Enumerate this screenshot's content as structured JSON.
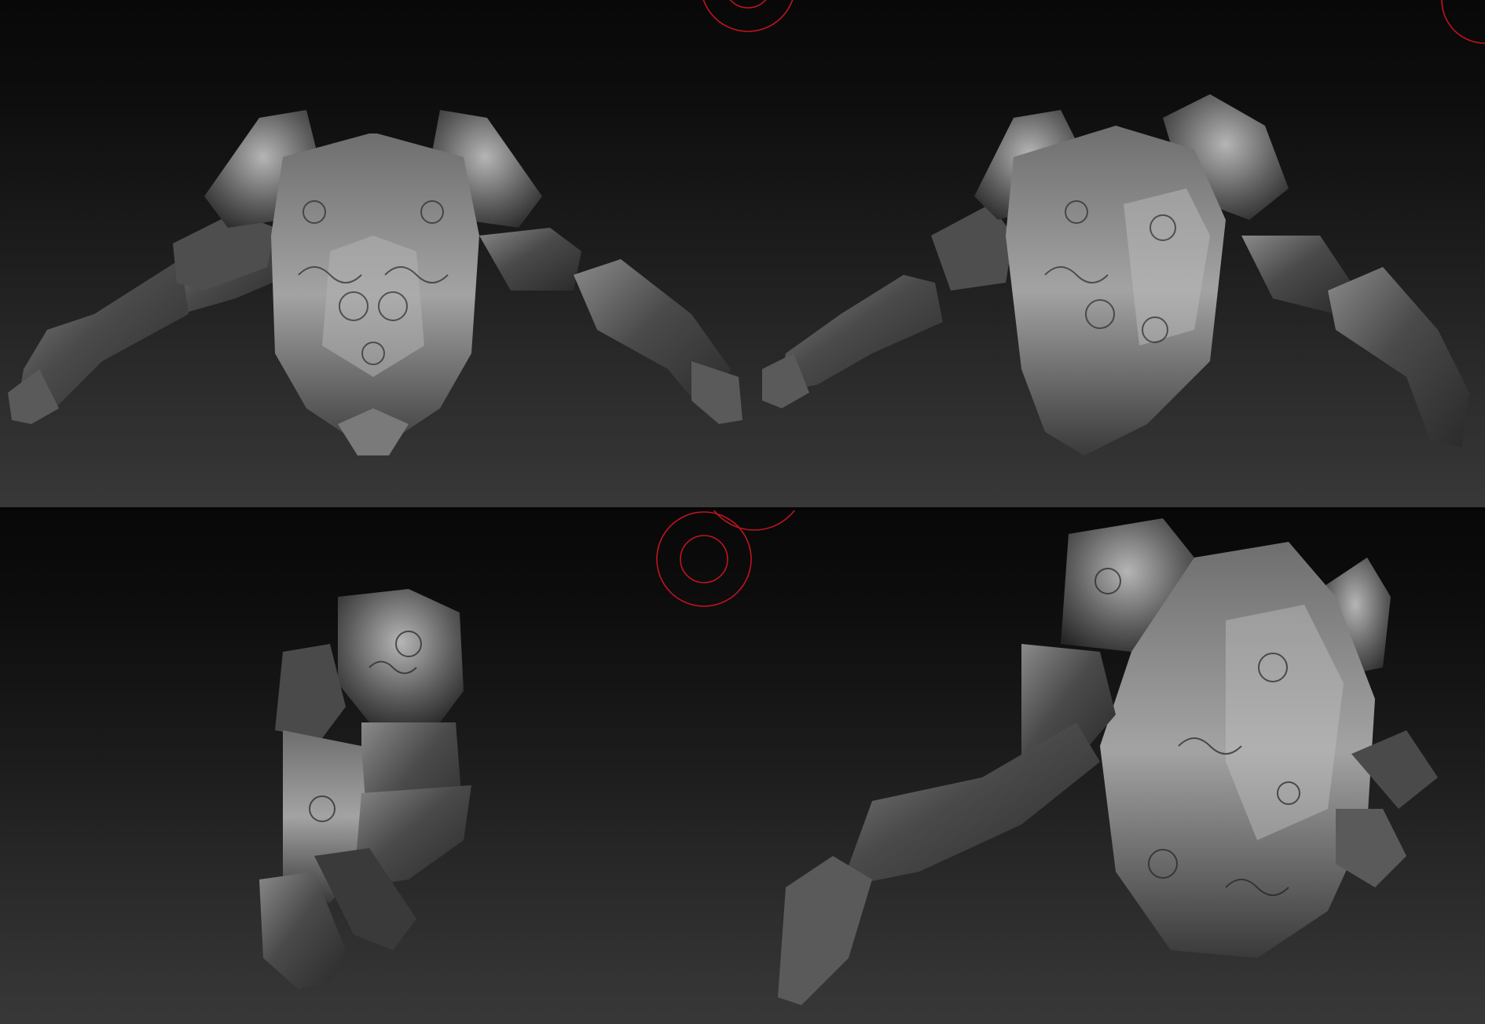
{
  "viewports": [
    {
      "view": "front",
      "subject": "armor-torso-with-arms"
    },
    {
      "view": "three-quarter",
      "subject": "armor-torso-with-arms"
    },
    {
      "view": "side",
      "subject": "armor-shoulder-and-arm"
    },
    {
      "view": "perspective",
      "subject": "armor-torso-with-arms"
    }
  ],
  "colors": {
    "background_top": "#080808",
    "background_bottom": "#383838",
    "metal_dark": "#2e2e2e",
    "metal_mid": "#5a5a5a",
    "metal_light": "#9a9a9a",
    "cursor_ring": "#c0141e"
  },
  "icons": [
    "brush-cursor-ring-icon"
  ]
}
